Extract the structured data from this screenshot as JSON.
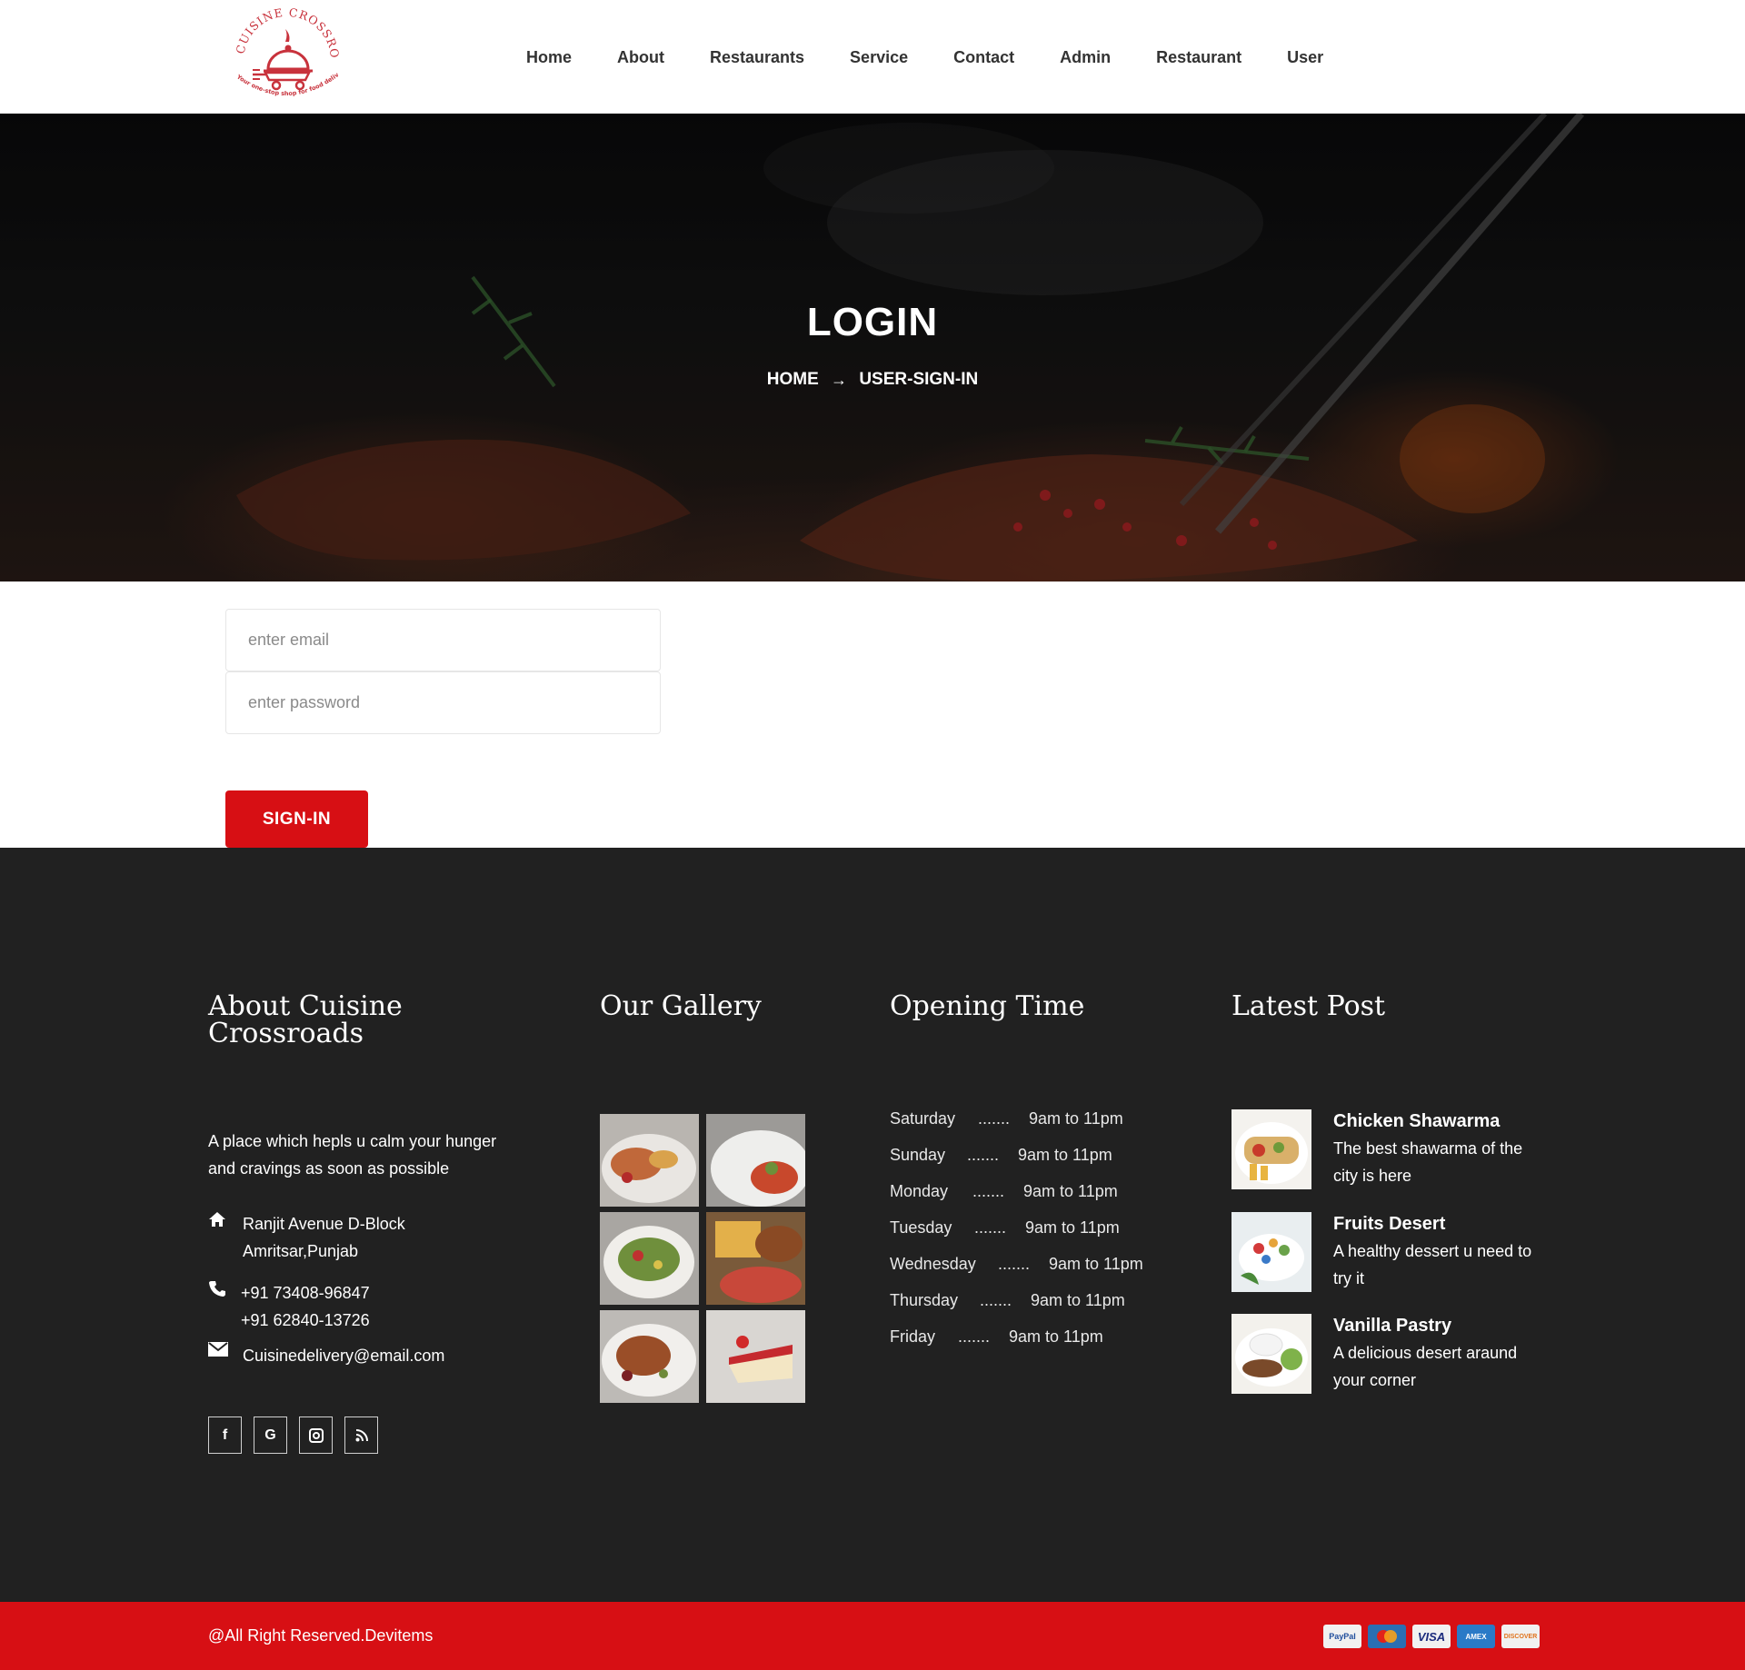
{
  "brand": {
    "logo_text_top": "CUISINE CROSSROADS",
    "logo_text_bottom": "Your one-stop shop for food delivery",
    "colors": {
      "accent": "#d70f14",
      "footer_bg": "#212121",
      "logo": "#c8323c"
    }
  },
  "nav": {
    "items": [
      {
        "label": "Home"
      },
      {
        "label": "About"
      },
      {
        "label": "Restaurants"
      },
      {
        "label": "Service"
      },
      {
        "label": "Contact"
      },
      {
        "label": "Admin"
      },
      {
        "label": "Restaurant"
      },
      {
        "label": "User"
      }
    ]
  },
  "hero": {
    "title": "LOGIN",
    "breadcrumb": {
      "home": "HOME",
      "separator_icon": "arrow-right-icon",
      "current": "USER-SIGN-IN"
    }
  },
  "login": {
    "email_placeholder": "enter email",
    "email_value": "",
    "password_placeholder": "enter password",
    "password_value": "",
    "submit_label": "SIGN-IN"
  },
  "footer": {
    "about": {
      "title": "About Cuisine Crossroads",
      "description": "A place which hepls u calm your hunger and cravings as soon as possible",
      "address_icon": "home-icon",
      "address_line1": "Ranjit Avenue D-Block",
      "address_line2": "Amritsar,Punjab",
      "phone_icon": "phone-icon",
      "phone1": "+91 73408-96847",
      "phone2": "+91 62840-13726",
      "email_icon": "mail-icon",
      "email": "Cuisinedelivery@email.com",
      "socials": [
        {
          "icon": "facebook-icon",
          "glyph": "f"
        },
        {
          "icon": "google-icon",
          "glyph": "G"
        },
        {
          "icon": "instagram-icon",
          "glyph": "◘"
        },
        {
          "icon": "rss-icon",
          "glyph": ")"
        }
      ]
    },
    "gallery": {
      "title": "Our Gallery",
      "images": [
        "dish-1",
        "dish-2",
        "dish-3",
        "dish-4",
        "dish-5",
        "dish-6"
      ]
    },
    "hours": {
      "title": "Opening Time",
      "rows": [
        {
          "day": "Saturday",
          "dots": ".......",
          "time": "9am to 11pm"
        },
        {
          "day": "Sunday",
          "dots": ".......",
          "time": "9am to 11pm"
        },
        {
          "day": "Monday",
          "dots": ".......",
          "time": "9am to 11pm"
        },
        {
          "day": "Tuesday",
          "dots": ".......",
          "time": "9am to 11pm"
        },
        {
          "day": "Wednesday",
          "dots": ".......",
          "time": "9am to 11pm"
        },
        {
          "day": "Thursday",
          "dots": ".......",
          "time": "9am to 11pm"
        },
        {
          "day": "Friday",
          "dots": ".......",
          "time": "9am to 11pm"
        }
      ]
    },
    "posts": {
      "title": "Latest Post",
      "items": [
        {
          "title": "Chicken Shawarma",
          "desc": "The best shawarma of the city is here"
        },
        {
          "title": "Fruits Desert",
          "desc": "A healthy dessert u need to try it"
        },
        {
          "title": "Vanilla Pastry",
          "desc": "A delicious desert araund your corner"
        }
      ]
    }
  },
  "bottom": {
    "copyright": "@All Right Reserved.Devitems",
    "payment_cards": [
      {
        "label": "PayPal",
        "color": "#1f4d9c"
      },
      {
        "label": "MC",
        "color": "#e25d1b"
      },
      {
        "label": "VISA",
        "color": "#1a2a7c"
      },
      {
        "label": "AMEX",
        "color": "#2a7ac7"
      },
      {
        "label": "DISCOVER",
        "color": "#e0731c"
      }
    ]
  }
}
